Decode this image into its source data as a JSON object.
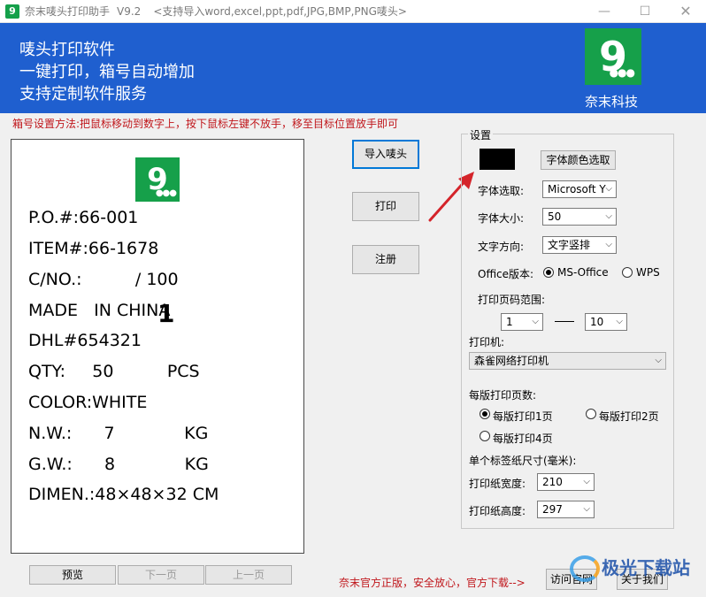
{
  "window": {
    "title": "奈末唛头打印助手",
    "version": "V9.2",
    "subtitle": "<支持导入word,excel,ppt,pdf,JPG,BMP,PNG唛头>",
    "min_glyph": "—",
    "max_glyph": "☐",
    "close_glyph": "✕"
  },
  "banner": {
    "line1": "唛头打印软件",
    "line2": "一键打印，箱号自动增加",
    "line3": "支持定制软件服务",
    "brand": "奈末科技",
    "logo_char": "9",
    "logo_dots": "●●●"
  },
  "instruction": "箱号设置方法:把鼠标移动到数字上，按下鼠标左键不放手，移至目标位置放手即可",
  "label": {
    "lines": [
      "P.O.#:66-001",
      "ITEM#:66-1678",
      "C/NO.:          / 100",
      "MADE   IN CHINA",
      "DHL#654321",
      "QTY:     50          PCS",
      "COLOR:WHITE",
      "N.W.:      7             KG",
      "G.W.:      8             KG",
      "DIMEN.:48×48×32 CM"
    ],
    "box_number": "1"
  },
  "buttons": {
    "import": "导入唛头",
    "print": "打印",
    "register": "注册",
    "color_pick": "字体颜色选取",
    "preview": "预览",
    "next_page": "下一页",
    "prev_page": "上一页",
    "visit_site": "访问官网",
    "about": "关于我们"
  },
  "settings": {
    "group_title": "设置",
    "font_label": "字体选取:",
    "font_value": "Microsoft Y",
    "size_label": "字体大小:",
    "size_value": "50",
    "direction_label": "文字方向:",
    "direction_value": "文字竖排",
    "office_label": "Office版本:",
    "office_ms": "MS-Office",
    "office_wps": "WPS",
    "range_label": "打印页码范围:",
    "range_from": "1",
    "range_to": "10",
    "printer_label": "打印机:",
    "printer_value": "森雀网络打印机",
    "per_sheet_label": "每版打印页数:",
    "per_sheet_1": "每版打印1页",
    "per_sheet_2": "每版打印2页",
    "per_sheet_4": "每版打印4页",
    "paper_label": "单个标签纸尺寸(毫米):",
    "width_label": "打印纸宽度:",
    "width_value": "210",
    "height_label": "打印纸高度:",
    "height_value": "297",
    "chevron": "⌵"
  },
  "footer": {
    "note": "奈末官方正版，安全放心，官方下载-->"
  },
  "watermark": {
    "text": "极光下载站"
  },
  "colors": {
    "banner": "#1f5fcf",
    "logo_green": "#16a04a",
    "accent_red": "#c0161b",
    "arrow_red": "#d4242a"
  }
}
